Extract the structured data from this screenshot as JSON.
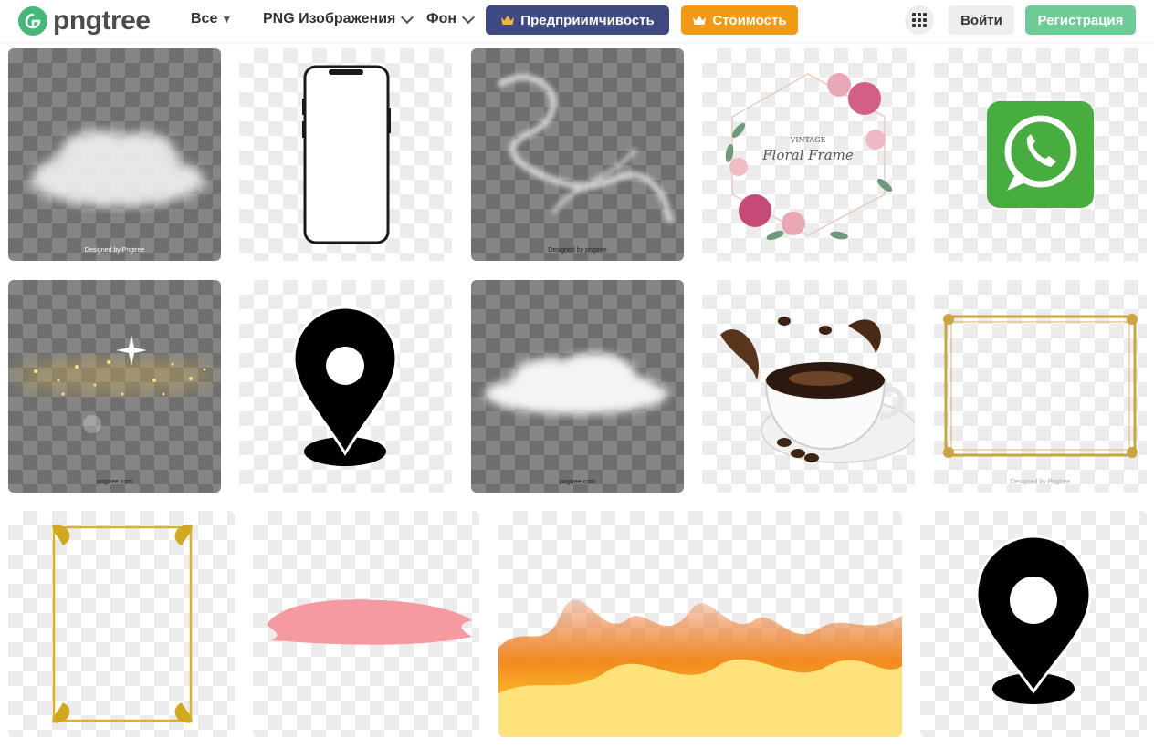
{
  "header": {
    "logo_text": "pngtree",
    "nav": {
      "all": "Все",
      "png": "PNG Изображения",
      "bg": "Фон"
    },
    "enterprise_label": "Предприимчивость",
    "price_label": "Стоимость",
    "login_label": "Войти",
    "register_label": "Регистрация"
  },
  "colors": {
    "brand_green": "#43b878",
    "enterprise": "#404a82",
    "price": "#f39a14",
    "register": "#6dcc95"
  },
  "icons": [
    "logo-icon",
    "crown-icon",
    "apps-grid-icon",
    "caret-down-icon",
    "chevron-down-icon"
  ],
  "tiles": [
    {
      "subject": "cloud",
      "watermark": "Designed by Pngtree"
    },
    {
      "subject": "smartphone-frame",
      "watermark": ""
    },
    {
      "subject": "smoke",
      "watermark": "Designed by pngtree"
    },
    {
      "subject": "floral-frame",
      "watermark": "",
      "caption_top": "VINTAGE",
      "caption_main": "Floral Frame"
    },
    {
      "subject": "whatsapp-logo",
      "watermark": ""
    },
    {
      "subject": "gold-sparkles",
      "watermark": "pngtree.com"
    },
    {
      "subject": "location-pin",
      "watermark": ""
    },
    {
      "subject": "cloud",
      "watermark": "pngtree.com"
    },
    {
      "subject": "coffee-cup-splash",
      "watermark": ""
    },
    {
      "subject": "gold-frame",
      "watermark": "Designed by Pngtree"
    },
    {
      "subject": "gold-ornate-frame",
      "watermark": ""
    },
    {
      "subject": "pink-brush-stroke",
      "watermark": ""
    },
    {
      "subject": "fire-flames",
      "watermark": ""
    },
    {
      "subject": "location-pin",
      "watermark": ""
    }
  ]
}
